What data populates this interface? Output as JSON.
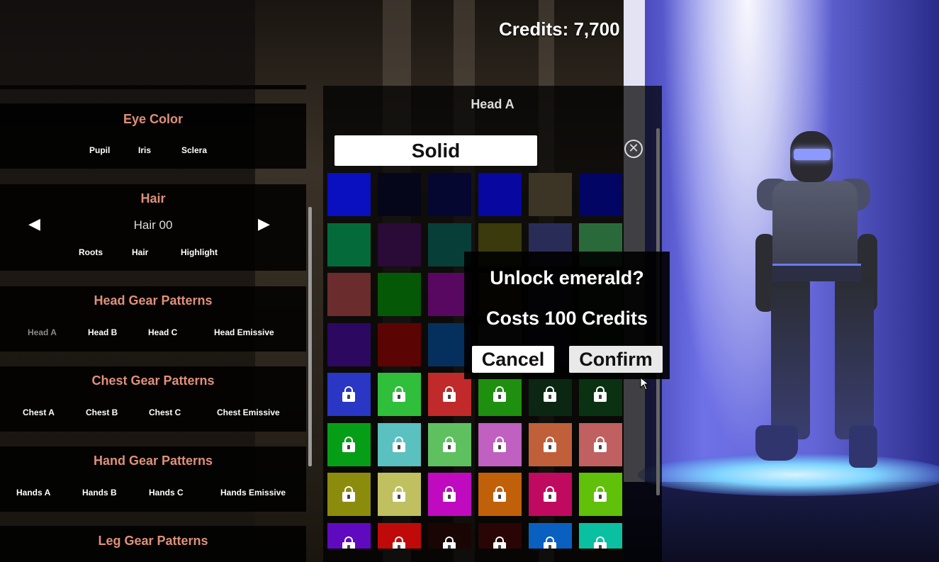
{
  "credits": "Credits: 7,700",
  "left_panel": {
    "sections": [
      {
        "title": "Eye Color",
        "options": [
          "Pupil",
          "Iris",
          "Sclera"
        ]
      },
      {
        "title": "Hair",
        "current": "Hair 00",
        "options": [
          "Roots",
          "Hair",
          "Highlight"
        ]
      },
      {
        "title": "Head Gear Patterns",
        "options": [
          "Head A",
          "Head B",
          "Head C",
          "Head Emissive"
        ],
        "selected": "Head A"
      },
      {
        "title": "Chest Gear Patterns",
        "options": [
          "Chest A",
          "Chest B",
          "Chest C",
          "Chest Emissive"
        ]
      },
      {
        "title": "Hand Gear Patterns",
        "options": [
          "Hands A",
          "Hands B",
          "Hands C",
          "Hands Emissive"
        ]
      },
      {
        "title": "Leg Gear Patterns",
        "options": []
      }
    ],
    "prev_arrow": "◀",
    "next_arrow": "▶"
  },
  "color_panel": {
    "title": "Head A",
    "mode_label": "Solid",
    "close_icon": "close-circle-icon",
    "swatches": [
      {
        "color": "#0a0fbf",
        "locked": false
      },
      {
        "color": "#05061a",
        "locked": false
      },
      {
        "color": "#050730",
        "locked": false
      },
      {
        "color": "#0808a0",
        "locked": false
      },
      {
        "color": "#3c3526",
        "locked": false
      },
      {
        "color": "#030565",
        "locked": false
      },
      {
        "color": "#056a3a",
        "locked": false
      },
      {
        "color": "#2a0a36",
        "locked": false
      },
      {
        "color": "#083e38",
        "locked": false
      },
      {
        "color": "#3b3a0c",
        "locked": false
      },
      {
        "color": "#2a2c58",
        "locked": false
      },
      {
        "color": "#2a6a3a",
        "locked": false
      },
      {
        "color": "#6a2c2c",
        "locked": false
      },
      {
        "color": "#055805",
        "locked": false
      },
      {
        "color": "#580860",
        "locked": false
      },
      {
        "color": "#3b2a10",
        "locked": false
      },
      {
        "color": "#20203a",
        "locked": false
      },
      {
        "color": "#1a3a1a",
        "locked": false
      },
      {
        "color": "#2c0860",
        "locked": false
      },
      {
        "color": "#5a0404",
        "locked": false
      },
      {
        "color": "#05305e",
        "locked": false
      },
      {
        "color": "#3a3a3a",
        "locked": false
      },
      {
        "color": "#1a1a2a",
        "locked": false
      },
      {
        "color": "#1a2a1a",
        "locked": false
      },
      {
        "color": "#2a36c4",
        "locked": true
      },
      {
        "color": "#2fbf3a",
        "locked": true
      },
      {
        "color": "#c02a2a",
        "locked": true
      },
      {
        "color": "#1f8f0f",
        "locked": true
      },
      {
        "color": "#0b2612",
        "locked": true
      },
      {
        "color": "#0a3212",
        "locked": true
      },
      {
        "color": "#079e17",
        "locked": true
      },
      {
        "color": "#5ac0c0",
        "locked": true
      },
      {
        "color": "#5fc060",
        "locked": true
      },
      {
        "color": "#c060c0",
        "locked": true
      },
      {
        "color": "#c0603a",
        "locked": true
      },
      {
        "color": "#c06060",
        "locked": true
      },
      {
        "color": "#8c8c0c",
        "locked": true
      },
      {
        "color": "#c0c060",
        "locked": true
      },
      {
        "color": "#c00ac0",
        "locked": true
      },
      {
        "color": "#c06008",
        "locked": true
      },
      {
        "color": "#c00a60",
        "locked": true
      },
      {
        "color": "#60c00a",
        "locked": true
      },
      {
        "color": "#600ac0",
        "locked": true
      },
      {
        "color": "#c00a0a",
        "locked": true
      },
      {
        "color": "#1a0505",
        "locked": true
      },
      {
        "color": "#2a0505",
        "locked": true
      },
      {
        "color": "#0a60c0",
        "locked": true
      },
      {
        "color": "#0ac0a0",
        "locked": true
      }
    ]
  },
  "dialog": {
    "question": "Unlock emerald?",
    "cost": "Costs 100 Credits",
    "cancel": "Cancel",
    "confirm": "Confirm"
  }
}
